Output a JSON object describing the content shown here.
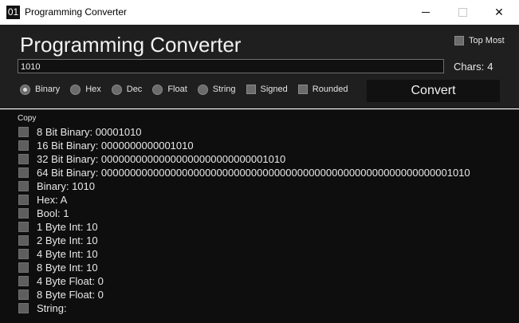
{
  "window": {
    "icon_text": "01",
    "title": "Programming Converter"
  },
  "header": {
    "title": "Programming Converter",
    "top_most_label": "Top Most",
    "top_most_checked": false
  },
  "input": {
    "value": "1010",
    "chars_label": "Chars:",
    "chars_value": "4"
  },
  "options": {
    "radios": [
      {
        "label": "Binary",
        "selected": true
      },
      {
        "label": "Hex",
        "selected": false
      },
      {
        "label": "Dec",
        "selected": false
      },
      {
        "label": "Float",
        "selected": false
      },
      {
        "label": "String",
        "selected": false
      }
    ],
    "checkboxes": [
      {
        "label": "Signed",
        "checked": false
      },
      {
        "label": "Rounded",
        "checked": false
      }
    ],
    "convert_label": "Convert"
  },
  "results": {
    "copy_label": "Copy",
    "rows": [
      "8 Bit Binary: 00001010",
      "16 Bit Binary: 0000000000001010",
      "32 Bit Binary: 00000000000000000000000000001010",
      "64 Bit Binary: 0000000000000000000000000000000000000000000000000000000000001010",
      "Binary: 1010",
      "Hex: A",
      "Bool: 1",
      "1 Byte Int: 10",
      "2 Byte Int: 10",
      "4 Byte Int: 10",
      "8 Byte Int: 10",
      "4 Byte Float: 0",
      "8 Byte Float: 0",
      "String:"
    ]
  }
}
